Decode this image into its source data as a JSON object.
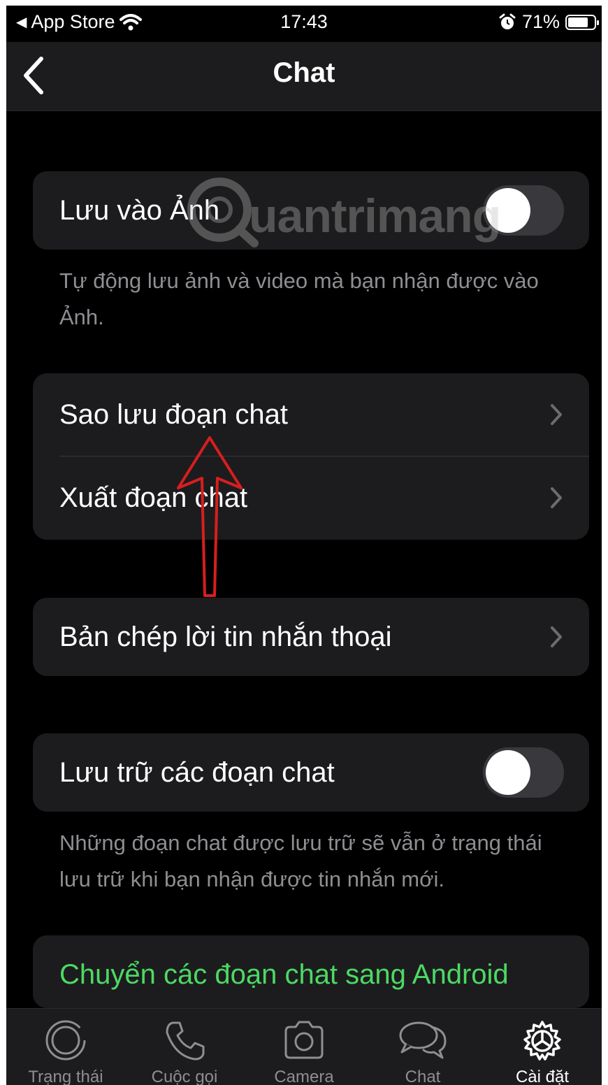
{
  "status_bar": {
    "back_app": "App Store",
    "time": "17:43",
    "battery": "71%",
    "battery_level": 0.71
  },
  "navbar": {
    "title": "Chat",
    "back_icon": "chevron-left-icon"
  },
  "settings": {
    "save_to_photos": {
      "label": "Lưu vào Ảnh",
      "enabled": false,
      "footnote": "Tự động lưu ảnh và video mà bạn nhận được vào Ảnh."
    },
    "chat_backup": {
      "label": "Sao lưu đoạn chat"
    },
    "export_chat": {
      "label": "Xuất đoạn chat"
    },
    "voice_transcripts": {
      "label": "Bản chép lời tin nhắn thoại"
    },
    "archive_chats": {
      "label": "Lưu trữ các đoạn chat",
      "enabled": false,
      "footnote": "Những đoạn chat được lưu trữ sẽ vẫn ở trạng thái lưu trữ khi bạn nhận được tin nhắn mới."
    },
    "move_to_android": {
      "label": "Chuyển các đoạn chat sang Android",
      "color": "#4cd964"
    }
  },
  "watermark": "uantrimang",
  "tabbar": {
    "tabs": [
      {
        "label": "Trạng thái",
        "icon": "status-ring-icon"
      },
      {
        "label": "Cuộc gọi",
        "icon": "phone-icon"
      },
      {
        "label": "Camera",
        "icon": "camera-icon"
      },
      {
        "label": "Chat",
        "icon": "chat-bubbles-icon"
      },
      {
        "label": "Cài đặt",
        "icon": "gear-icon",
        "active": true
      }
    ]
  },
  "colors": {
    "background": "#000000",
    "card": "#1c1c1e",
    "secondary_text": "#8e8e93",
    "accent_green": "#4cd964",
    "annotation_arrow": "#d81e1e"
  }
}
